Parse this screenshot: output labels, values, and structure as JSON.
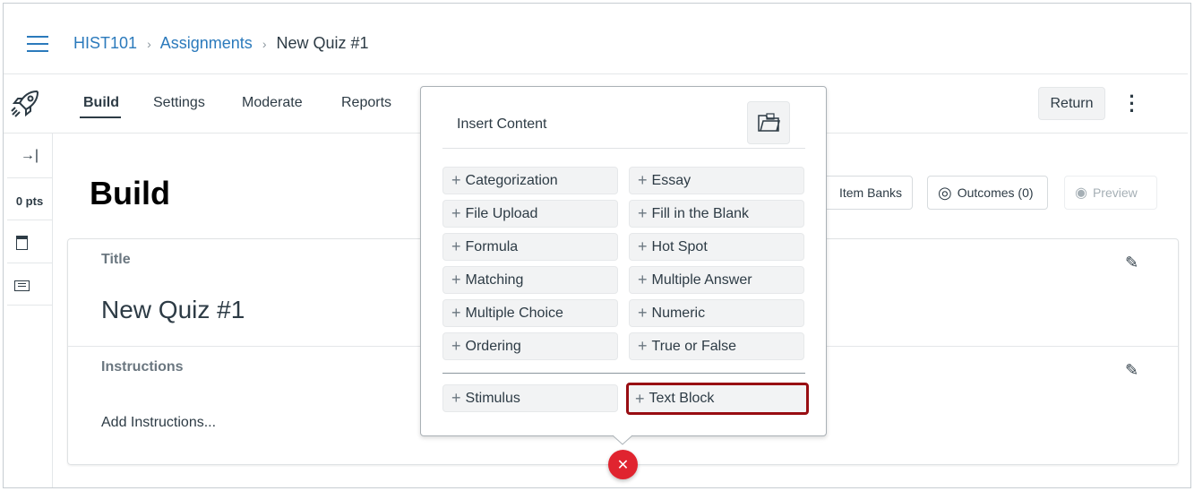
{
  "breadcrumb": {
    "course": "HIST101",
    "section": "Assignments",
    "current": "New Quiz #1",
    "separator": "›"
  },
  "tabs": [
    {
      "label": "Build",
      "active": true
    },
    {
      "label": "Settings"
    },
    {
      "label": "Moderate"
    },
    {
      "label": "Reports"
    }
  ],
  "return_label": "Return",
  "sidebar": {
    "points": "0 pts"
  },
  "page_title": "Build",
  "toolbar": {
    "item_banks": "Item Banks",
    "outcomes": "Outcomes (0)",
    "preview": "Preview"
  },
  "card": {
    "title_label": "Title",
    "title_value": "New Quiz #1",
    "instructions_label": "Instructions",
    "instructions_placeholder": "Add Instructions..."
  },
  "popover": {
    "heading": "Insert Content",
    "question_types": [
      "Categorization",
      "Essay",
      "File Upload",
      "Fill in the Blank",
      "Formula",
      "Hot Spot",
      "Matching",
      "Multiple Answer",
      "Multiple Choice",
      "Numeric",
      "Ordering",
      "True or False"
    ],
    "other": [
      "Stimulus",
      "Text Block"
    ],
    "selected": "Text Block"
  },
  "colors": {
    "link": "#2b7abc",
    "highlight": "#980d12",
    "close": "#e0242f"
  }
}
